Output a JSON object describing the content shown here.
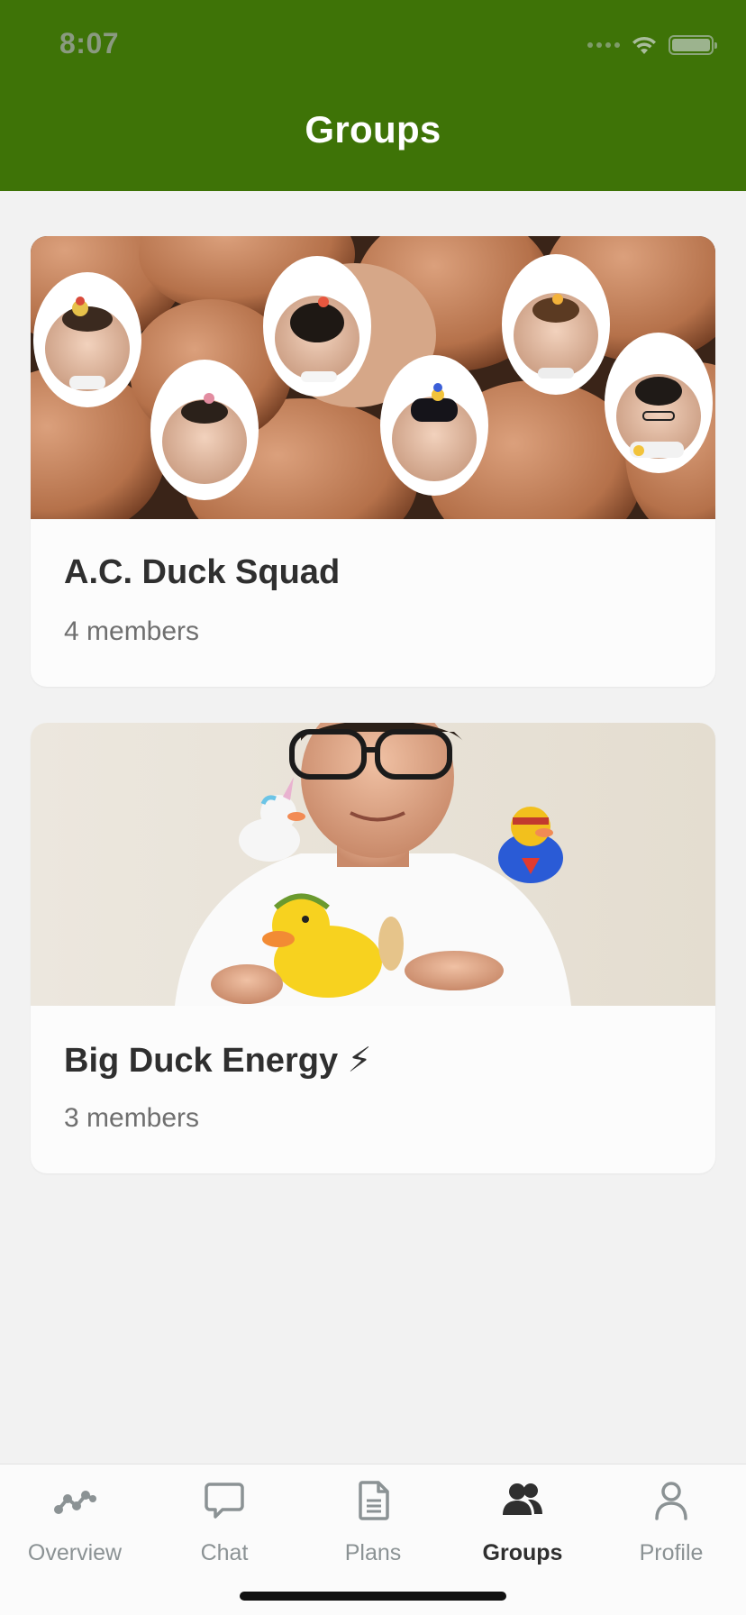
{
  "status_bar": {
    "time": "8:07"
  },
  "header": {
    "title": "Groups",
    "background": "#3e7307"
  },
  "groups": [
    {
      "name": "A.C. Duck Squad",
      "members": "4 members",
      "image": "group-photo-eggs-faces"
    },
    {
      "name": "Big Duck Energy ⚡",
      "members": "3 members",
      "image": "group-photo-man-rubber-ducks"
    }
  ],
  "tabbar": {
    "active": "Groups",
    "items": [
      {
        "label": "Overview",
        "icon": "overview-icon"
      },
      {
        "label": "Chat",
        "icon": "chat-icon"
      },
      {
        "label": "Plans",
        "icon": "plans-icon"
      },
      {
        "label": "Groups",
        "icon": "groups-icon"
      },
      {
        "label": "Profile",
        "icon": "profile-icon"
      }
    ]
  },
  "colors": {
    "accent_green": "#3e7307",
    "page_background": "#f2f2f2",
    "inactive_tab": "#8b9294"
  }
}
